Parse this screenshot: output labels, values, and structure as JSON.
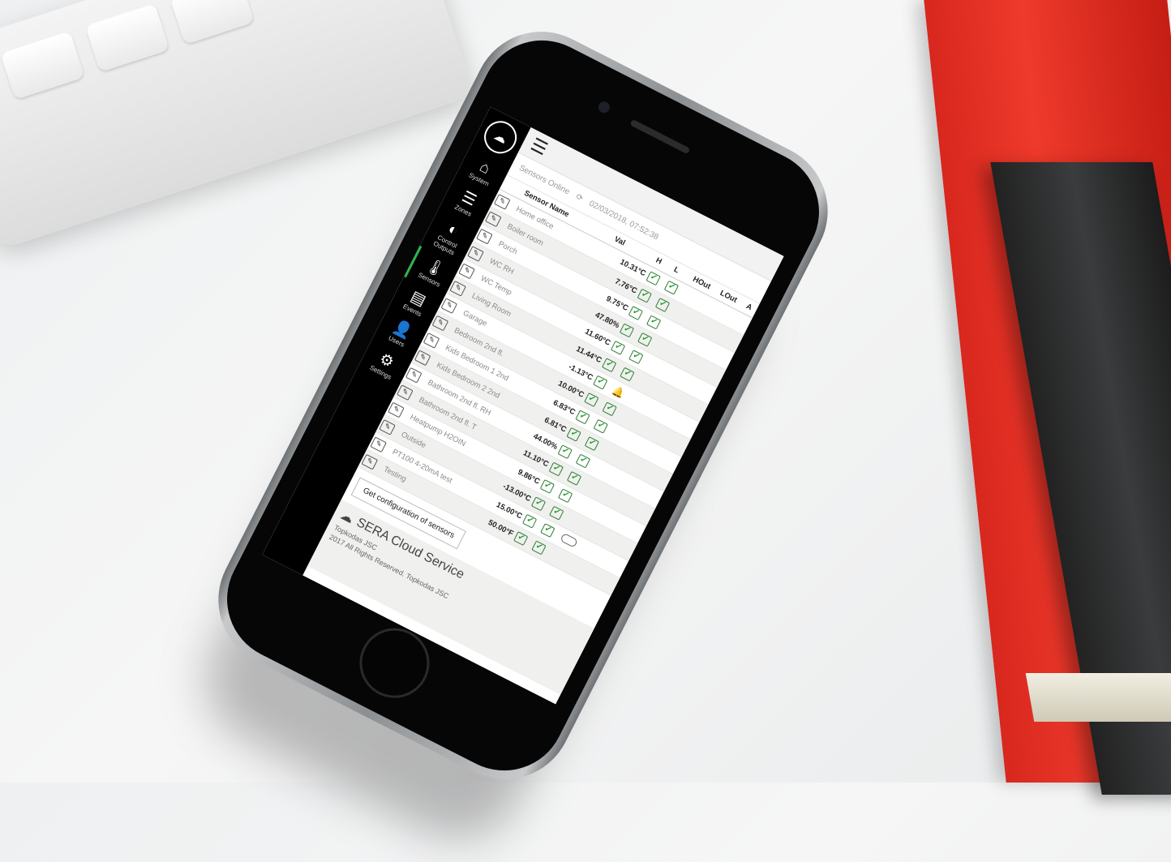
{
  "sidebar": {
    "logo_icon": "cloud-icon",
    "items": [
      {
        "label": "System",
        "icon": "home-icon"
      },
      {
        "label": "Zones",
        "icon": "list-icon"
      },
      {
        "label": "Control Outputs",
        "icon": "toggle-icon"
      },
      {
        "label": "Sensors",
        "icon": "thermometer-icon",
        "active": true
      },
      {
        "label": "Events",
        "icon": "events-icon"
      },
      {
        "label": "Users",
        "icon": "user-icon"
      },
      {
        "label": "Settings",
        "icon": "gear-icon"
      }
    ]
  },
  "status": {
    "label": "Sensors Online",
    "timestamp": "02/03/2018, 07:52:38"
  },
  "table": {
    "headers": [
      "Sensor Name",
      "Val",
      "H",
      "L",
      "HOut",
      "LOut",
      "A"
    ],
    "rows": [
      {
        "name": "Home office",
        "value": "10.31°C",
        "h": "check",
        "l": "check"
      },
      {
        "name": "Boiler room",
        "value": "7.76°C",
        "h": "check",
        "l": "check"
      },
      {
        "name": "Porch",
        "value": "9.75°C",
        "h": "check",
        "l": "check"
      },
      {
        "name": "WC RH",
        "value": "47.80%",
        "h": "check",
        "l": "check"
      },
      {
        "name": "WC Temp",
        "value": "11.60°C",
        "h": "check",
        "l": "check"
      },
      {
        "name": "Living Room",
        "value": "11.44°C",
        "h": "check",
        "l": "check"
      },
      {
        "name": "Garage",
        "value": "-1.13°C",
        "h": "check",
        "l": "bell"
      },
      {
        "name": "Bedroom 2nd fl.",
        "value": "10.00°C",
        "h": "check",
        "l": "check"
      },
      {
        "name": "Kids Bedroom 1 2nd",
        "value": "6.83°C",
        "h": "check",
        "l": "check"
      },
      {
        "name": "Kids Bedroom 2 2nd",
        "value": "6.81°C",
        "h": "check",
        "l": "check"
      },
      {
        "name": "Bathroom 2nd fl. RH",
        "value": "44.00%",
        "h": "check",
        "l": "check"
      },
      {
        "name": "Bathroom 2nd fl. T",
        "value": "11.10°C",
        "h": "check",
        "l": "check"
      },
      {
        "name": "Heatpump H2OIN",
        "value": "9.86°C",
        "h": "check",
        "l": "check"
      },
      {
        "name": "Outside",
        "value": "-13.00°C",
        "h": "check",
        "l": "check"
      },
      {
        "name": "PT100 4-20mA test",
        "value": "15.00°C",
        "h": "check",
        "l": "check",
        "extra": "toggle"
      },
      {
        "name": "Testing",
        "value": "50.00°F",
        "h": "check",
        "l": "check"
      }
    ]
  },
  "config_button": "Get configuration of sensors",
  "footer": {
    "brand": "SERA Cloud Service",
    "company": "Topkodas JSC",
    "rights": "2017 All Rights Reserved. Topkodas JSC"
  },
  "colors": {
    "accent": "#2fb34d",
    "alarm": "#e01818",
    "check": "#1d9a2b"
  }
}
